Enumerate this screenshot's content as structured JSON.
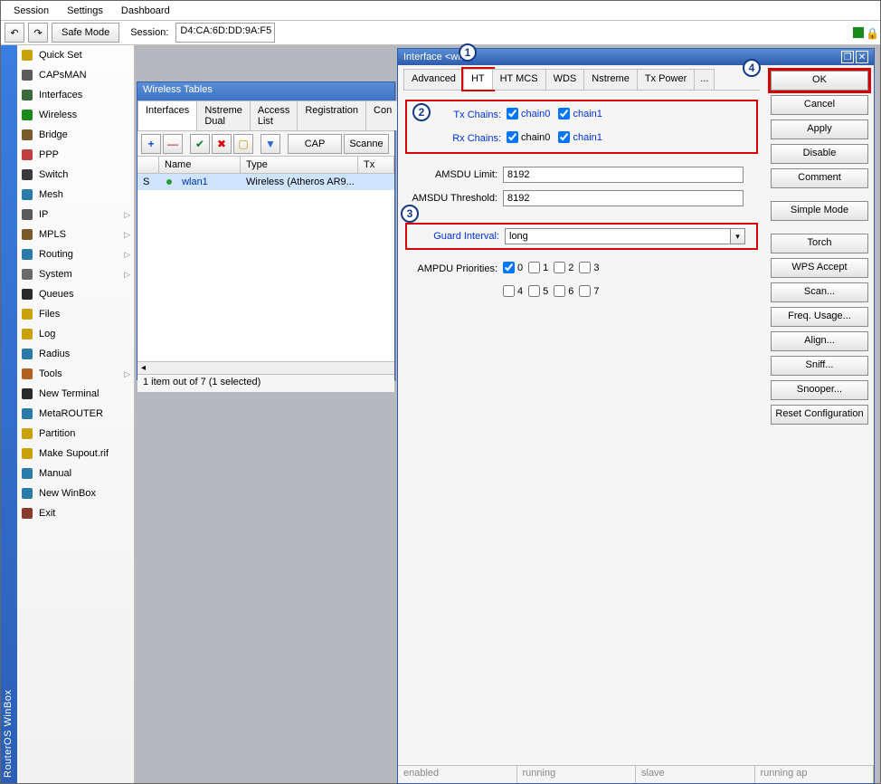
{
  "menu": {
    "session": "Session",
    "settings": "Settings",
    "dashboard": "Dashboard"
  },
  "toolbar": {
    "undo_icon": "↶",
    "redo_icon": "↷",
    "safe_mode": "Safe Mode",
    "session_label": "Session:",
    "session_value": "D4:CA:6D:DD:9A:F5"
  },
  "rail": "RouterOS WinBox",
  "sidebar": {
    "items": [
      {
        "label": "Quick Set"
      },
      {
        "label": "CAPsMAN"
      },
      {
        "label": "Interfaces"
      },
      {
        "label": "Wireless"
      },
      {
        "label": "Bridge"
      },
      {
        "label": "PPP"
      },
      {
        "label": "Switch"
      },
      {
        "label": "Mesh"
      },
      {
        "label": "IP",
        "sub": true
      },
      {
        "label": "MPLS",
        "sub": true
      },
      {
        "label": "Routing",
        "sub": true
      },
      {
        "label": "System",
        "sub": true
      },
      {
        "label": "Queues"
      },
      {
        "label": "Files"
      },
      {
        "label": "Log"
      },
      {
        "label": "Radius"
      },
      {
        "label": "Tools",
        "sub": true
      },
      {
        "label": "New Terminal"
      },
      {
        "label": "MetaROUTER"
      },
      {
        "label": "Partition"
      },
      {
        "label": "Make Supout.rif"
      },
      {
        "label": "Manual"
      },
      {
        "label": "New WinBox"
      },
      {
        "label": "Exit"
      }
    ]
  },
  "wt": {
    "title": "Wireless Tables",
    "tabs": [
      "Interfaces",
      "Nstreme Dual",
      "Access List",
      "Registration",
      "Con"
    ],
    "tool_add": "+",
    "tool_del": "—",
    "tool_en": "✔",
    "tool_dis": "✖",
    "tool_cmt": "▢",
    "tool_filt": "▼",
    "tool_cap": "CAP",
    "tool_scan": "Scanne",
    "cols": [
      "",
      "Name",
      "Type",
      "Tx"
    ],
    "row": {
      "flag": "S",
      "name": "wlan1",
      "type": "Wireless (Atheros AR9...",
      "tx": ""
    },
    "scroll_left": "◂",
    "status": "1 item out of 7 (1 selected)"
  },
  "ifwin": {
    "title": "Interface <wlan",
    "tabs": [
      "Advanced",
      "HT",
      "HT MCS",
      "WDS",
      "Nstreme",
      "Tx Power"
    ],
    "tab_more": "...",
    "buttons": [
      "OK",
      "Cancel",
      "Apply",
      "Disable",
      "Comment",
      "Simple Mode",
      "Torch",
      "WPS Accept",
      "Scan...",
      "Freq. Usage...",
      "Align...",
      "Sniff...",
      "Snooper...",
      "Reset Configuration"
    ],
    "labels": {
      "tx_chains": "Tx Chains:",
      "rx_chains": "Rx Chains:",
      "chain0": "chain0",
      "chain1": "chain1",
      "amsdu_limit": "AMSDU Limit:",
      "amsdu_threshold": "AMSDU Threshold:",
      "guard": "Guard Interval:",
      "ampdu": "AMPDU Priorities:"
    },
    "values": {
      "amsdu_limit": "8192",
      "amsdu_threshold": "8192",
      "guard": "long"
    },
    "ampdu_opts": [
      "0",
      "1",
      "2",
      "3",
      "4",
      "5",
      "6",
      "7"
    ],
    "status": [
      "enabled",
      "running",
      "slave",
      "running ap"
    ]
  },
  "callouts": {
    "c1": "1",
    "c2": "2",
    "c3": "3",
    "c4": "4"
  },
  "icons": {
    "quick": "#c9a20a",
    "caps": "#5b5b5b",
    "ifaces": "#3a6a3a",
    "wifi": "#1a8a1a",
    "bridge": "#7a5a2a",
    "ppp": "#c04040",
    "switch": "#3a3a3a",
    "mesh": "#2a7aaa",
    "ip": "#5a5a5a",
    "mpls": "#7a5a2a",
    "routing": "#2a7aaa",
    "system": "#6a6a6a",
    "queues": "#2a2a2a",
    "files": "#c9a20a",
    "log": "#c9a20a",
    "radius": "#2a7aaa",
    "tools": "#b06020",
    "term": "#2a2a2a",
    "meta": "#2a7aaa",
    "part": "#c9a20a",
    "supout": "#c9a20a",
    "manual": "#2a7aaa",
    "winbox": "#2a7aaa",
    "exit": "#8a3a2a"
  }
}
